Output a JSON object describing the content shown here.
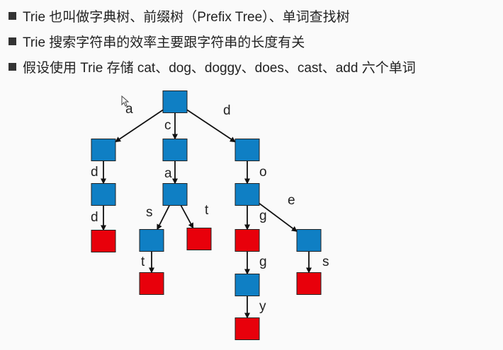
{
  "bullets": [
    "Trie 也叫做字典树、前缀树（Prefix Tree）、单词查找树",
    "Trie 搜索字符串的效率主要跟字符串的长度有关",
    "假设使用 Trie 存储 cat、dog、doggy、does、cast、add 六个单词"
  ],
  "colors": {
    "internal_node": "#0f7fc4",
    "word_end_node": "#e8000b",
    "node_border": "#222222",
    "edge": "#111111"
  },
  "trie": {
    "nodes": [
      {
        "id": "root",
        "end": false
      },
      {
        "id": "a",
        "end": false
      },
      {
        "id": "ad",
        "end": false
      },
      {
        "id": "add",
        "end": true
      },
      {
        "id": "c",
        "end": false
      },
      {
        "id": "ca",
        "end": false
      },
      {
        "id": "cas",
        "end": false
      },
      {
        "id": "cast",
        "end": true
      },
      {
        "id": "cat",
        "end": true
      },
      {
        "id": "d",
        "end": false
      },
      {
        "id": "do",
        "end": false
      },
      {
        "id": "dog",
        "end": true
      },
      {
        "id": "dogg",
        "end": false
      },
      {
        "id": "doggy",
        "end": true
      },
      {
        "id": "doe",
        "end": false
      },
      {
        "id": "does",
        "end": true
      }
    ],
    "edges": [
      {
        "from": "root",
        "to": "a",
        "label": "a"
      },
      {
        "from": "root",
        "to": "c",
        "label": "c"
      },
      {
        "from": "root",
        "to": "d",
        "label": "d"
      },
      {
        "from": "a",
        "to": "ad",
        "label": "d"
      },
      {
        "from": "ad",
        "to": "add",
        "label": "d"
      },
      {
        "from": "c",
        "to": "ca",
        "label": "a"
      },
      {
        "from": "ca",
        "to": "cas",
        "label": "s"
      },
      {
        "from": "ca",
        "to": "cat",
        "label": "t"
      },
      {
        "from": "cas",
        "to": "cast",
        "label": "t"
      },
      {
        "from": "d",
        "to": "do",
        "label": "o"
      },
      {
        "from": "do",
        "to": "dog",
        "label": "g"
      },
      {
        "from": "do",
        "to": "doe",
        "label": "e"
      },
      {
        "from": "dog",
        "to": "dogg",
        "label": "g"
      },
      {
        "from": "dogg",
        "to": "doggy",
        "label": "y"
      },
      {
        "from": "doe",
        "to": "does",
        "label": "s"
      }
    ]
  }
}
